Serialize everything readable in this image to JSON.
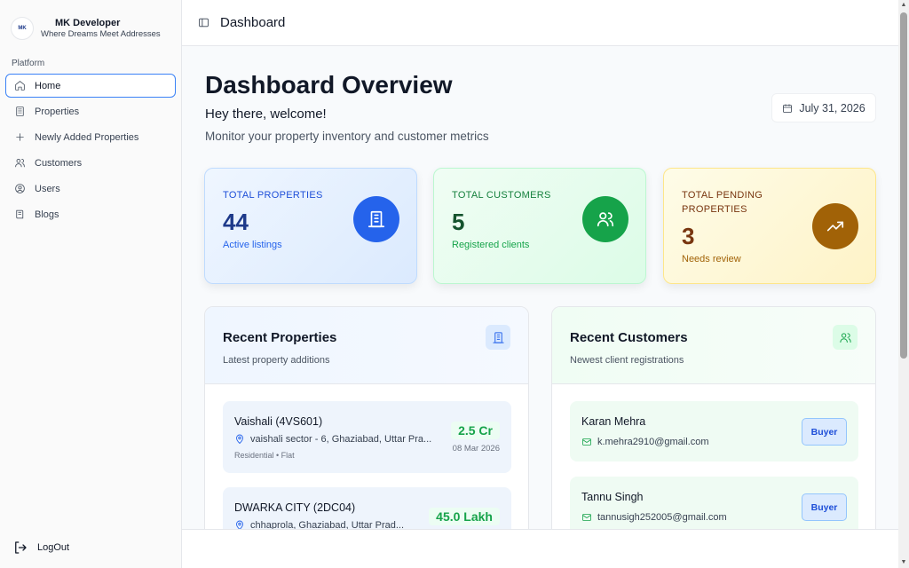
{
  "brand": {
    "logo_text": "MK",
    "name": "MK Developer",
    "tagline": "Where Dreams Meet Addresses"
  },
  "sidebar": {
    "group_label": "Platform",
    "items": [
      {
        "label": "Home",
        "icon": "home-icon"
      },
      {
        "label": "Properties",
        "icon": "building-icon"
      },
      {
        "label": "Newly Added Properties",
        "icon": "plus-icon"
      },
      {
        "label": "Customers",
        "icon": "users-icon"
      },
      {
        "label": "Users",
        "icon": "user-circle-icon"
      },
      {
        "label": "Blogs",
        "icon": "book-icon"
      }
    ],
    "active_index": 0,
    "logout_label": "LogOut"
  },
  "header": {
    "title": "Dashboard"
  },
  "main": {
    "title": "Dashboard Overview",
    "welcome": "Hey there, welcome!",
    "subtitle": "Monitor your property inventory and customer metrics",
    "date": "July 31, 2026",
    "stats": [
      {
        "label": "TOTAL PROPERTIES",
        "value": "44",
        "sub": "Active listings",
        "color": "#2563eb"
      },
      {
        "label": "TOTAL CUSTOMERS",
        "value": "5",
        "sub": "Registered clients",
        "color": "#16a34a"
      },
      {
        "label": "TOTAL PENDING PROPERTIES",
        "value": "3",
        "sub": "Needs review",
        "color": "#a16207"
      }
    ],
    "recent_properties": {
      "title": "Recent Properties",
      "subtitle": "Latest property additions",
      "items": [
        {
          "name": "Vaishali (4VS601)",
          "location": "vaishali sector - 6, Ghaziabad, Uttar Pra...",
          "meta": "Residential • Flat",
          "price": "2.5 Cr",
          "date": "08 Mar 2026"
        },
        {
          "name": "DWARKA CITY (2DC04)",
          "location": "chhaprola, Ghaziabad, Uttar Prad...",
          "meta": "",
          "price": "45.0 Lakh",
          "date": ""
        }
      ]
    },
    "recent_customers": {
      "title": "Recent Customers",
      "subtitle": "Newest client registrations",
      "items": [
        {
          "name": "Karan Mehra",
          "email": "k.mehra2910@gmail.com",
          "badge": "Buyer"
        },
        {
          "name": "Tannu Singh",
          "email": "tannusigh252005@gmail.com",
          "badge": "Buyer"
        }
      ]
    }
  }
}
